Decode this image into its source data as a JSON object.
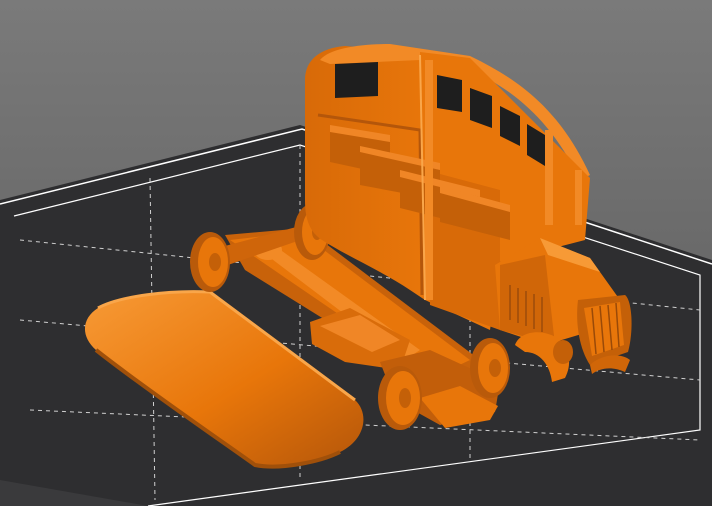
{
  "viewport": {
    "background_color": "#6a6a6a",
    "bed_color": "#2e2e30",
    "bed_edge_color": "#ffffff",
    "grid_color": "#d8d8d8",
    "model_color": "#e8760a",
    "model_shade_color": "#b4560a",
    "model_highlight_color": "#f79a36"
  },
  "objects": [
    {
      "name": "bus-body-part"
    },
    {
      "name": "chassis-part"
    },
    {
      "name": "roof-part"
    }
  ]
}
